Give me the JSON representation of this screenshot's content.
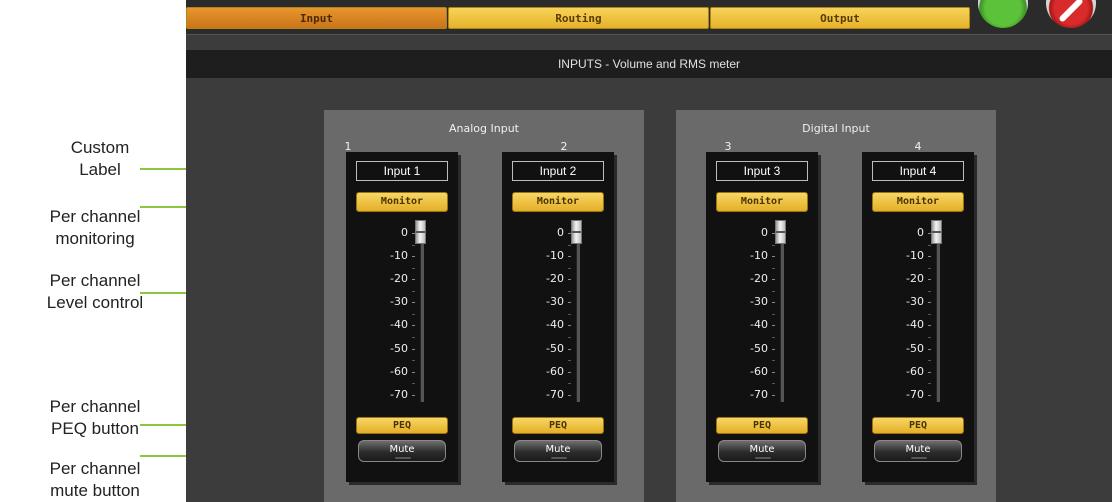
{
  "annotations": [
    {
      "key": "custom_label",
      "text": "Custom\nLabel"
    },
    {
      "key": "monitoring",
      "text": "Per channel\nmonitoring"
    },
    {
      "key": "level",
      "text": "Per channel\nLevel control"
    },
    {
      "key": "peq",
      "text": "Per channel\nPEQ button"
    },
    {
      "key": "mute",
      "text": "Per channel\nmute button"
    }
  ],
  "tabs": [
    {
      "label": "Input",
      "active": true
    },
    {
      "label": "Routing",
      "active": false
    },
    {
      "label": "Output",
      "active": false
    }
  ],
  "page_title": "INPUTS - Volume and RMS meter",
  "groups": [
    {
      "title": "Analog Input"
    },
    {
      "title": "Digital Input"
    }
  ],
  "channels": [
    {
      "number": "1",
      "label": "Input 1",
      "monitor": "Monitor",
      "peq": "PEQ",
      "mute": "Mute",
      "level_db": 0
    },
    {
      "number": "2",
      "label": "Input 2",
      "monitor": "Monitor",
      "peq": "PEQ",
      "mute": "Mute",
      "level_db": 0
    },
    {
      "number": "3",
      "label": "Input 3",
      "monitor": "Monitor",
      "peq": "PEQ",
      "mute": "Mute",
      "level_db": 0
    },
    {
      "number": "4",
      "label": "Input 4",
      "monitor": "Monitor",
      "peq": "PEQ",
      "mute": "Mute",
      "level_db": 0
    }
  ],
  "scale_labels": [
    "0",
    "-10",
    "-20",
    "-30",
    "-40",
    "-50",
    "-60",
    "-70"
  ],
  "colors": {
    "accent": "#e4ae26",
    "active_tab": "#d27e22",
    "annotation_arrow": "#8cc63f"
  },
  "icons": {
    "ok": "ok-check-icon",
    "cancel": "cancel-no-icon"
  }
}
